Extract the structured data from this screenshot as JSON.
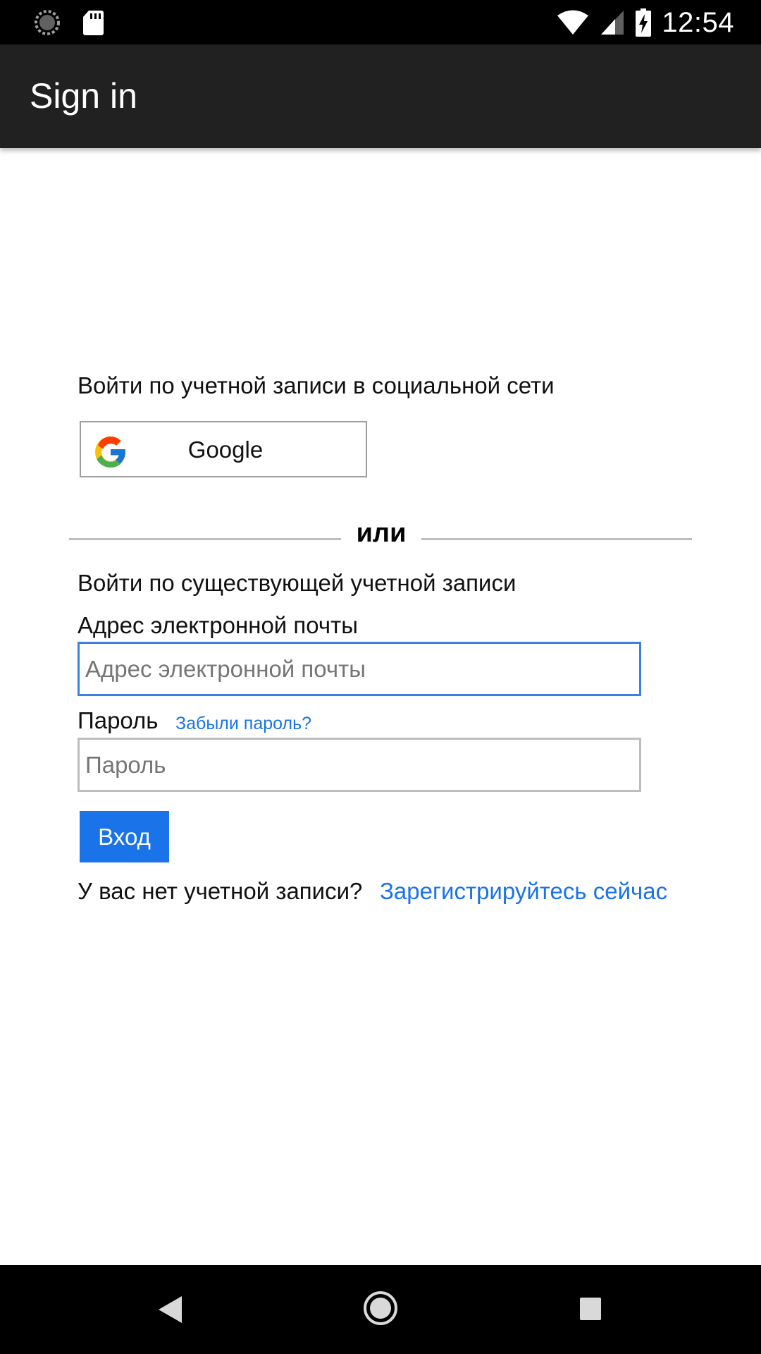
{
  "status_bar": {
    "time": "12:54"
  },
  "app_bar": {
    "title": "Sign in"
  },
  "social": {
    "heading": "Войти по учетной записи в социальной сети",
    "google_label": "Google"
  },
  "divider": {
    "text": "или"
  },
  "login": {
    "heading": "Войти по существующей учетной записи",
    "email_label": "Адрес электронной почты",
    "email_placeholder": "Адрес электронной почты",
    "password_label": "Пароль",
    "forgot_label": "Забыли пароль?",
    "password_placeholder": "Пароль",
    "submit_label": "Вход"
  },
  "register": {
    "prompt": "У вас нет учетной записи?",
    "link_label": "Зарегистрируйтесь сейчас"
  },
  "colors": {
    "accent": "#1a73e8",
    "focus_border": "#3b82e0",
    "app_bar": "#212121"
  }
}
